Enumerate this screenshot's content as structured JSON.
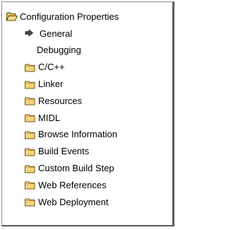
{
  "tree": {
    "root": {
      "label": "Configuration Properties",
      "icon": "open-folder-icon"
    },
    "items": [
      {
        "label": "General",
        "icon": "arrow-right-icon",
        "type": "arrow"
      },
      {
        "label": "Debugging",
        "icon": "",
        "type": "none"
      },
      {
        "label": "C/C++",
        "icon": "folder-icon",
        "type": "folder"
      },
      {
        "label": "Linker",
        "icon": "folder-icon",
        "type": "folder"
      },
      {
        "label": "Resources",
        "icon": "folder-icon",
        "type": "folder"
      },
      {
        "label": "MIDL",
        "icon": "folder-icon",
        "type": "folder"
      },
      {
        "label": "Browse Information",
        "icon": "folder-icon",
        "type": "folder"
      },
      {
        "label": "Build Events",
        "icon": "folder-icon",
        "type": "folder"
      },
      {
        "label": "Custom Build Step",
        "icon": "folder-icon",
        "type": "folder"
      },
      {
        "label": "Web References",
        "icon": "folder-icon",
        "type": "folder"
      },
      {
        "label": "Web Deployment",
        "icon": "folder-icon",
        "type": "folder"
      }
    ]
  },
  "colors": {
    "folder_fill": "#f3d27a",
    "folder_edge": "#7a5a10",
    "panel_border": "#5a5a5a"
  }
}
